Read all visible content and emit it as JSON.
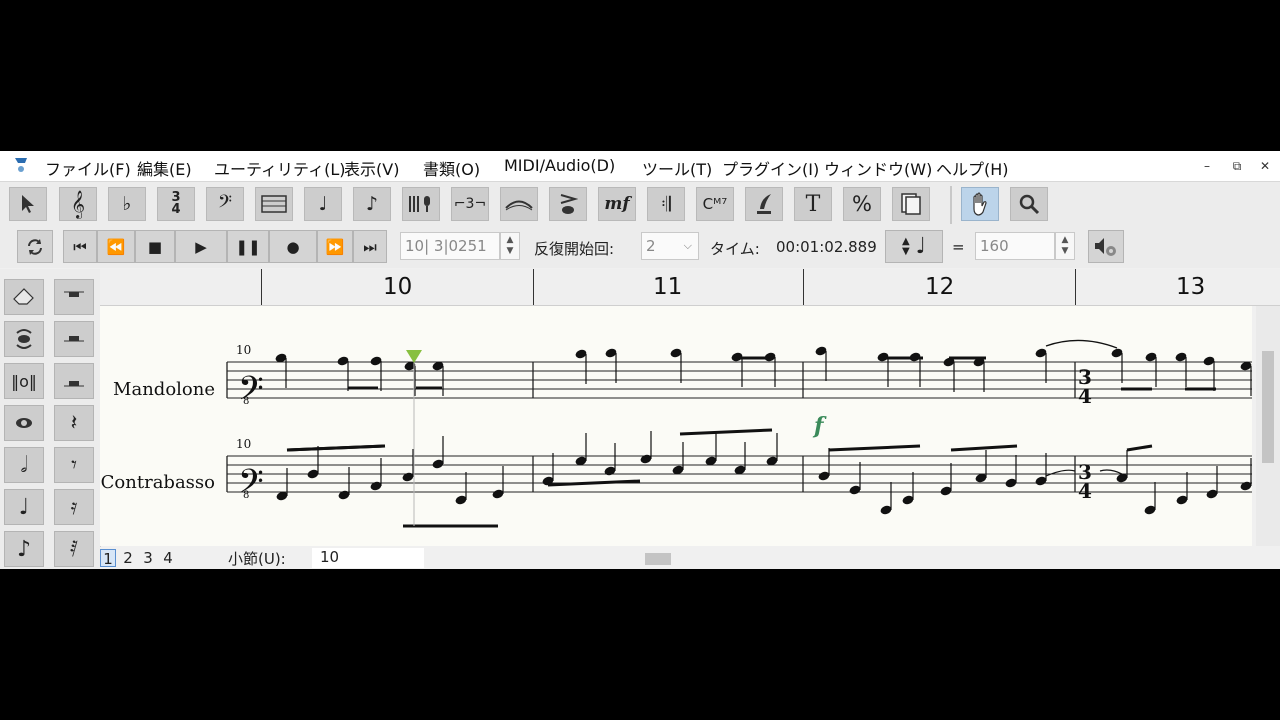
{
  "menu": [
    "ファイル(F)",
    "編集(E)",
    "ユーティリティ(L)",
    "表示(V)",
    "書類(O)",
    "MIDI/Audio(D)",
    "ツール(T)",
    "プラグイン(I)",
    "ウィンドウ(W)",
    "ヘルプ(H)"
  ],
  "window_controls": {
    "minimize": "–",
    "restore": "⧉",
    "close": "✕"
  },
  "toolbar": {
    "text_tool_label": "T",
    "percent_label": "%",
    "dynamic_label": "mf",
    "chord_label": "Cᴹ⁷"
  },
  "transport": {
    "position": "10| 3|0251",
    "repeat_label": "反復開始回:",
    "repeat_value": "2",
    "time_label": "タイム:",
    "time_value": "00:01:02.889",
    "equals": "=",
    "tempo_value": "160"
  },
  "measures": [
    "10",
    "11",
    "12",
    "13"
  ],
  "staves": [
    {
      "name": "Mandolone",
      "measure_number": "10"
    },
    {
      "name": "Contrabasso",
      "measure_number": "10"
    }
  ],
  "dynamic_marking": "f",
  "time_signature": {
    "top": "3",
    "bottom": "4"
  },
  "status": {
    "pages": [
      "1",
      "2",
      "3",
      "4"
    ],
    "selected_page": "1",
    "measure_label": "小節(U):",
    "measure_value": "10"
  },
  "colors": {
    "playback_cursor": "#88c040",
    "dynamic": "#3a8a5a",
    "highlight": "#bcd4ea"
  }
}
